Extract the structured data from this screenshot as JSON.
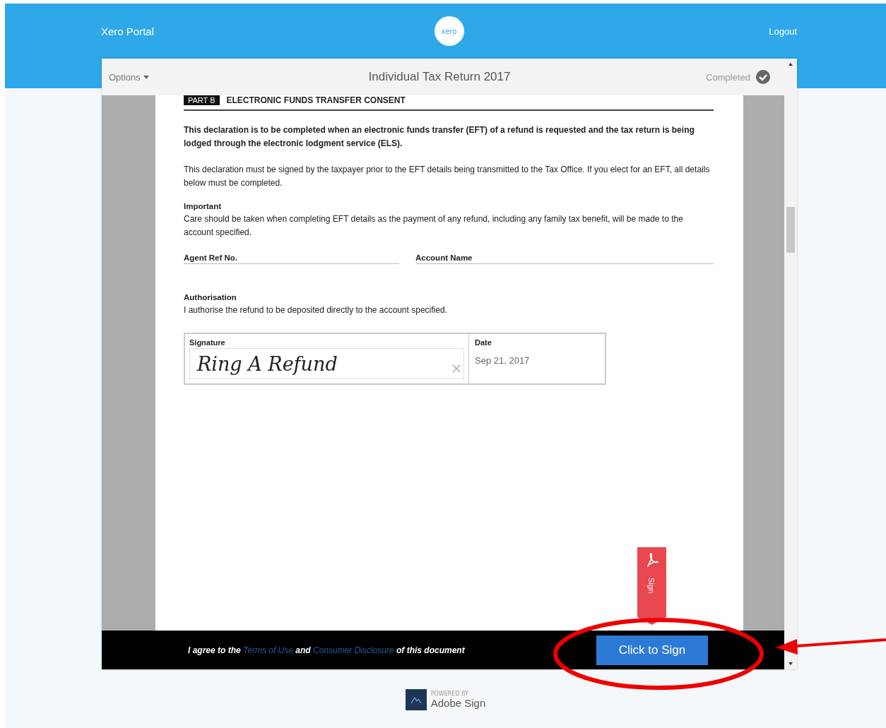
{
  "header": {
    "title": "Xero Portal",
    "logo": "xero",
    "logout": "Logout"
  },
  "toolbar": {
    "options": "Options",
    "title": "Individual Tax Return 2017",
    "status": "Completed",
    "completed": true
  },
  "document": {
    "part_tag": "PART B",
    "heading": "ELECTRONIC FUNDS TRANSFER CONSENT",
    "paragraphs": [
      {
        "text": "This declaration is to be completed when an electronic funds transfer (EFT) of a refund is requested and the tax return is being lodged through the electronic lodgment service (ELS).",
        "bold": true
      },
      {
        "text": "This declaration must be signed by the taxpayer prior to the EFT details being transmitted to the Tax Office. If you elect for an EFT, all details below must be completed.",
        "bold": false
      }
    ],
    "important": {
      "heading": "Important",
      "text": "Care should be taken when completing EFT details as the payment of any refund, including any family tax benefit, will be made to the account specified."
    },
    "fields": [
      {
        "label": "Agent Ref No."
      },
      {
        "label": "Account Name"
      }
    ],
    "authorisation": {
      "heading": "Authorisation",
      "text": "I authorise the refund to be deposited directly to the account specified."
    },
    "signature": {
      "label": "Signature",
      "value": "Ring A Refund",
      "date_label": "Date",
      "date": "Sep 21, 2017"
    },
    "sign_flag": "Sign"
  },
  "footer": {
    "agreement": [
      {
        "kind": "text",
        "text": "I agree to the"
      },
      {
        "kind": "link",
        "text": "Terms of Use"
      },
      {
        "kind": "text",
        "text": "and"
      },
      {
        "kind": "link",
        "text": "Consumer Disclosure"
      },
      {
        "kind": "text",
        "text": "of this document"
      }
    ],
    "button": "Click to Sign"
  },
  "powered": {
    "caption": "POWERED BY",
    "name": "Adobe Sign"
  }
}
